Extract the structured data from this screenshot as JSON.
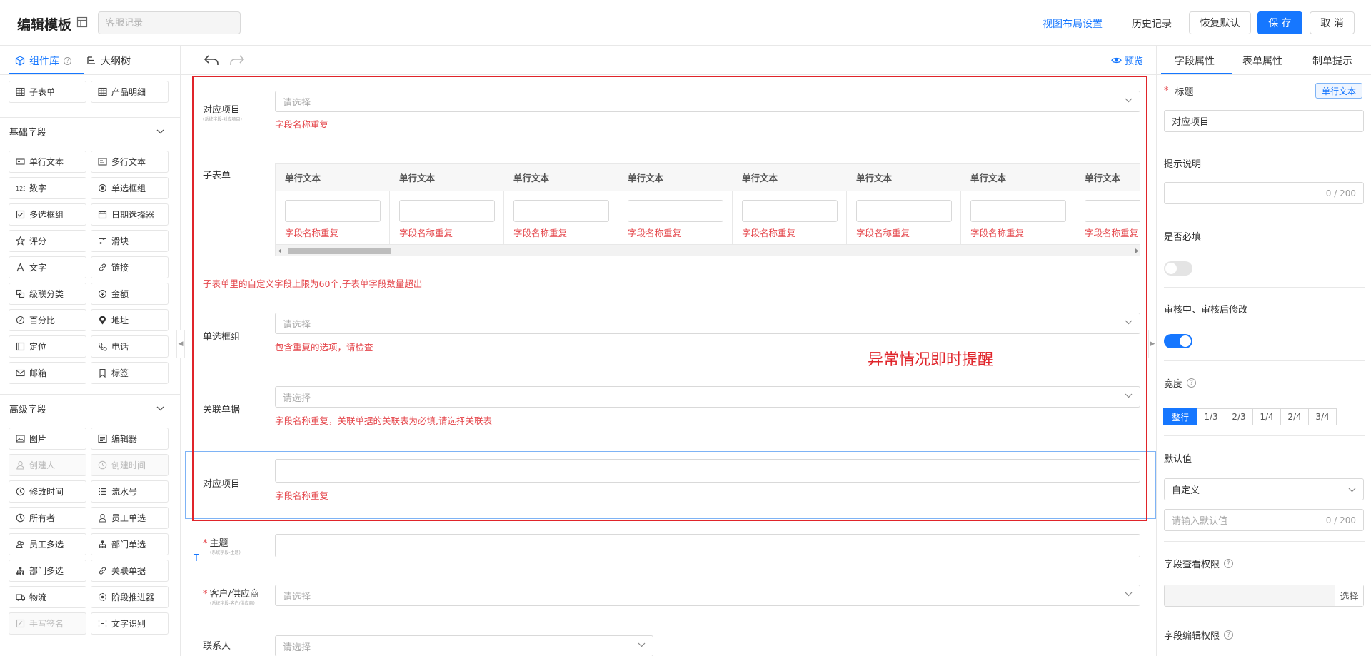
{
  "header": {
    "title": "编辑模板",
    "name_placeholder": "客服记录",
    "layout_settings": "视图布局设置",
    "history": "历史记录",
    "restore_default": "恢复默认",
    "save": "保 存",
    "cancel": "取 消"
  },
  "left_panel": {
    "tabs": [
      {
        "label": "组件库"
      },
      {
        "label": "大纲树"
      }
    ],
    "top_items": [
      {
        "label": "子表单",
        "icon": "table-icon"
      },
      {
        "label": "产品明细",
        "icon": "table-icon"
      }
    ],
    "basic_section": "基础字段",
    "basic_items": [
      {
        "label": "单行文本",
        "icon": "single-line-text-icon"
      },
      {
        "label": "多行文本",
        "icon": "multi-line-text-icon"
      },
      {
        "label": "数字",
        "icon": "number-icon"
      },
      {
        "label": "单选框组",
        "icon": "radio-icon"
      },
      {
        "label": "多选框组",
        "icon": "checkbox-icon"
      },
      {
        "label": "日期选择器",
        "icon": "calendar-icon"
      },
      {
        "label": "评分",
        "icon": "star-icon"
      },
      {
        "label": "滑块",
        "icon": "slider-icon"
      },
      {
        "label": "文字",
        "icon": "text-icon"
      },
      {
        "label": "链接",
        "icon": "link-icon"
      },
      {
        "label": "级联分类",
        "icon": "cascade-icon"
      },
      {
        "label": "金额",
        "icon": "amount-icon"
      },
      {
        "label": "百分比",
        "icon": "percent-icon"
      },
      {
        "label": "地址",
        "icon": "location-pin-icon"
      },
      {
        "label": "定位",
        "icon": "locate-icon"
      },
      {
        "label": "电话",
        "icon": "phone-icon"
      },
      {
        "label": "邮箱",
        "icon": "mail-icon"
      },
      {
        "label": "标签",
        "icon": "tag-icon"
      }
    ],
    "advanced_section": "高级字段",
    "advanced_items": [
      {
        "label": "图片",
        "icon": "image-icon",
        "disabled": false
      },
      {
        "label": "编辑器",
        "icon": "editor-icon",
        "disabled": false
      },
      {
        "label": "创建人",
        "icon": "user-icon",
        "disabled": true
      },
      {
        "label": "创建时间",
        "icon": "clock-icon",
        "disabled": true
      },
      {
        "label": "修改时间",
        "icon": "clock-icon",
        "disabled": false
      },
      {
        "label": "流水号",
        "icon": "serial-number-icon",
        "disabled": false
      },
      {
        "label": "所有者",
        "icon": "clock-icon",
        "disabled": false
      },
      {
        "label": "员工单选",
        "icon": "user-icon",
        "disabled": false
      },
      {
        "label": "员工多选",
        "icon": "users-icon",
        "disabled": false
      },
      {
        "label": "部门单选",
        "icon": "department-icon",
        "disabled": false
      },
      {
        "label": "部门多选",
        "icon": "department-icon",
        "disabled": false
      },
      {
        "label": "关联单据",
        "icon": "link-icon",
        "disabled": false
      },
      {
        "label": "物流",
        "icon": "truck-icon",
        "disabled": false
      },
      {
        "label": "阶段推进器",
        "icon": "stage-icon",
        "disabled": false
      },
      {
        "label": "手写签名",
        "icon": "signature-icon",
        "disabled": true
      },
      {
        "label": "文字识别",
        "icon": "ocr-icon",
        "disabled": false
      }
    ]
  },
  "canvas": {
    "preview": "预览",
    "placeholder": "请选择",
    "fields": {
      "f1_label": "对应项目",
      "f1_sub": "(系统字段-对应项目)",
      "f1_error": "字段名称重复",
      "subtable_label": "子表单",
      "subtable_columns": [
        {
          "header": "单行文本",
          "error": "字段名称重复"
        },
        {
          "header": "单行文本",
          "error": "字段名称重复"
        },
        {
          "header": "单行文本",
          "error": "字段名称重复"
        },
        {
          "header": "单行文本",
          "error": "字段名称重复"
        },
        {
          "header": "单行文本",
          "error": "字段名称重复"
        },
        {
          "header": "单行文本",
          "error": "字段名称重复"
        },
        {
          "header": "单行文本",
          "error": "字段名称重复"
        },
        {
          "header": "单行文本",
          "error": "字段名称重复"
        }
      ],
      "subtable_error": "子表单里的自定义字段上限为60个,子表单字段数量超出",
      "radio_label": "单选框组",
      "radio_error": "包含重复的选项，请检查",
      "related_label": "关联单据",
      "related_error": "字段名称重复，关联单据的关联表为必填,请选择关联表",
      "f5_label": "对应项目",
      "f5_error": "字段名称重复",
      "topic_label": "主题",
      "topic_sub": "(系统字段-主题)",
      "customer_label": "客户/供应商",
      "customer_sub": "(系统字段-客户/供应商)",
      "contact_label": "联系人"
    },
    "annotation": "异常情况即时提醒",
    "text_marker": "T"
  },
  "right_panel": {
    "tabs": [
      {
        "label": "字段属性"
      },
      {
        "label": "表单属性"
      },
      {
        "label": "制单提示"
      }
    ],
    "title_label": "标题",
    "type_badge": "单行文本",
    "title_value": "对应项目",
    "hint_label": "提示说明",
    "hint_count": "0 / 200",
    "required_label": "是否必填",
    "required_on": false,
    "modify_label": "审核中、审核后修改",
    "modify_on": true,
    "width_label": "宽度",
    "width_options": [
      {
        "label": "整行",
        "active": true
      },
      {
        "label": "1/3",
        "active": false
      },
      {
        "label": "2/3",
        "active": false
      },
      {
        "label": "1/4",
        "active": false
      },
      {
        "label": "2/4",
        "active": false
      },
      {
        "label": "3/4",
        "active": false
      }
    ],
    "default_label": "默认值",
    "default_select": "自定义",
    "default_placeholder": "请输入默认值",
    "default_count": "0 / 200",
    "view_perm_label": "字段查看权限",
    "select_btn": "选择",
    "edit_perm_label": "字段编辑权限"
  },
  "colors": {
    "primary": "#1677ff",
    "error": "#e5484d",
    "annotation": "#e0242a"
  }
}
